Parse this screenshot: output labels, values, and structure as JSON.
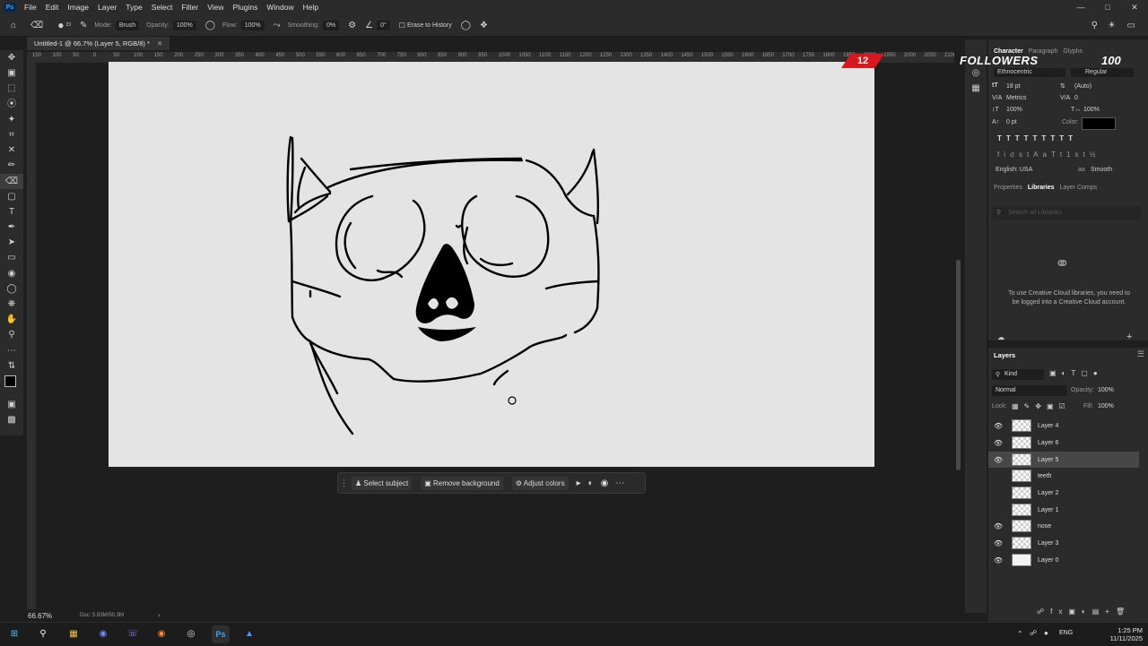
{
  "menubar": {
    "logo": "Ps",
    "items": [
      "File",
      "Edit",
      "Image",
      "Layer",
      "Type",
      "Select",
      "Filter",
      "View",
      "Plugins",
      "Window",
      "Help"
    ]
  },
  "options": {
    "brush_size": "23",
    "mode_label": "Mode:",
    "mode_value": "Brush",
    "opacity_label": "Opacity:",
    "opacity_value": "100%",
    "flow_label": "Flow:",
    "flow_value": "100%",
    "smoothing_label": "Smoothing:",
    "smoothing_value": "0%",
    "angle_value": "0°",
    "erase_history_label": "Erase to History"
  },
  "document": {
    "tab_title": "Untitled-1 @ 66.7% (Layer 5, RGB/8) *",
    "zoom": "66.67%",
    "doc_info": "Doc: 5.93M/50.3M"
  },
  "ruler_ticks": [
    "150",
    "100",
    "50",
    "0",
    "50",
    "100",
    "150",
    "200",
    "250",
    "300",
    "350",
    "400",
    "450",
    "500",
    "550",
    "600",
    "650",
    "700",
    "750",
    "800",
    "850",
    "900",
    "950",
    "1000",
    "1050",
    "1100",
    "1150",
    "1200",
    "1250",
    "1300",
    "1350",
    "1400",
    "1450",
    "1500",
    "1550",
    "1600",
    "1650",
    "1700",
    "1750",
    "1800",
    "1850",
    "1900",
    "1950",
    "2000",
    "2050",
    "2100"
  ],
  "contextual_taskbar": {
    "select_subject": "Select subject",
    "remove_background": "Remove background",
    "adjust_colors": "Adjust colors"
  },
  "overlay": {
    "followers_count": "12",
    "followers_label": "FOLLOWERS",
    "followers_goal": "100"
  },
  "character_panel": {
    "tabs": [
      "Character",
      "Paragraph",
      "Glyphs"
    ],
    "font_family": "Ethnocentric",
    "font_style": "Regular",
    "font_size": "18 pt",
    "leading": "(Auto)",
    "kerning": "Metrics",
    "tracking": "0",
    "vertical_scale": "100%",
    "horizontal_scale": "100%",
    "baseline_shift": "0 pt",
    "color_label": "Color:",
    "color": "#000000",
    "language": "English: USA",
    "antialias": "Smooth"
  },
  "libraries_panel": {
    "tabs": [
      "Properties",
      "Libraries",
      "Layer Comps"
    ],
    "search_placeholder": "Search all Libraries",
    "message": "To use Creative Cloud libraries, you need to be logged into a Creative Cloud account."
  },
  "layers_panel": {
    "title": "Layers",
    "kind_label": "Kind",
    "blend_mode": "Normal",
    "opacity_label": "Opacity:",
    "opacity_value": "100%",
    "lock_label": "Lock:",
    "fill_label": "Fill:",
    "fill_value": "100%",
    "layers": [
      {
        "name": "Layer 4",
        "visible": true,
        "selected": false
      },
      {
        "name": "Layer 6",
        "visible": true,
        "selected": false
      },
      {
        "name": "Layer 5",
        "visible": true,
        "selected": true
      },
      {
        "name": "teeth",
        "visible": false,
        "selected": false
      },
      {
        "name": "Layer 2",
        "visible": false,
        "selected": false
      },
      {
        "name": "Layer 1",
        "visible": false,
        "selected": false
      },
      {
        "name": "nose",
        "visible": true,
        "selected": false
      },
      {
        "name": "Layer 3",
        "visible": true,
        "selected": false
      },
      {
        "name": "Layer 0",
        "visible": true,
        "selected": false
      }
    ]
  },
  "taskbar": {
    "time": "1:25 PM",
    "date": "11/11/2025",
    "language": "ENG"
  }
}
